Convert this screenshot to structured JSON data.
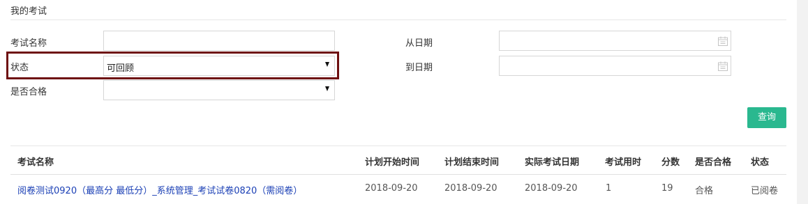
{
  "section": {
    "title": "我的考试"
  },
  "filters": {
    "exam_name_label": "考试名称",
    "exam_name_value": "",
    "status_label": "状态",
    "status_value": "可回顾",
    "passed_label": "是否合格",
    "passed_value": "",
    "from_date_label": "从日期",
    "from_date_value": "",
    "to_date_label": "到日期",
    "to_date_value": "",
    "query_label": "查询",
    "highlight_color": "#6e0f10",
    "button_color": "#2ab88f"
  },
  "table": {
    "headers": {
      "name": "考试名称",
      "plan_start": "计划开始时间",
      "plan_end": "计划结束时间",
      "actual_date": "实际考试日期",
      "duration": "考试用时",
      "score": "分数",
      "passed": "是否合格",
      "status": "状态"
    },
    "rows": [
      {
        "name": "阅卷测试0920（最高分 最低分）_系统管理_考试试卷0820（需阅卷）",
        "plan_start": "2018-09-20",
        "plan_end": "2018-09-20",
        "actual_date": "2018-09-20",
        "duration": "1",
        "score": "19",
        "passed": "合格",
        "status": "已阅卷"
      }
    ],
    "link_color": "#1a3fb5"
  },
  "icons": {
    "date": "calendar-icon",
    "dropdown": "caret-down-icon"
  }
}
